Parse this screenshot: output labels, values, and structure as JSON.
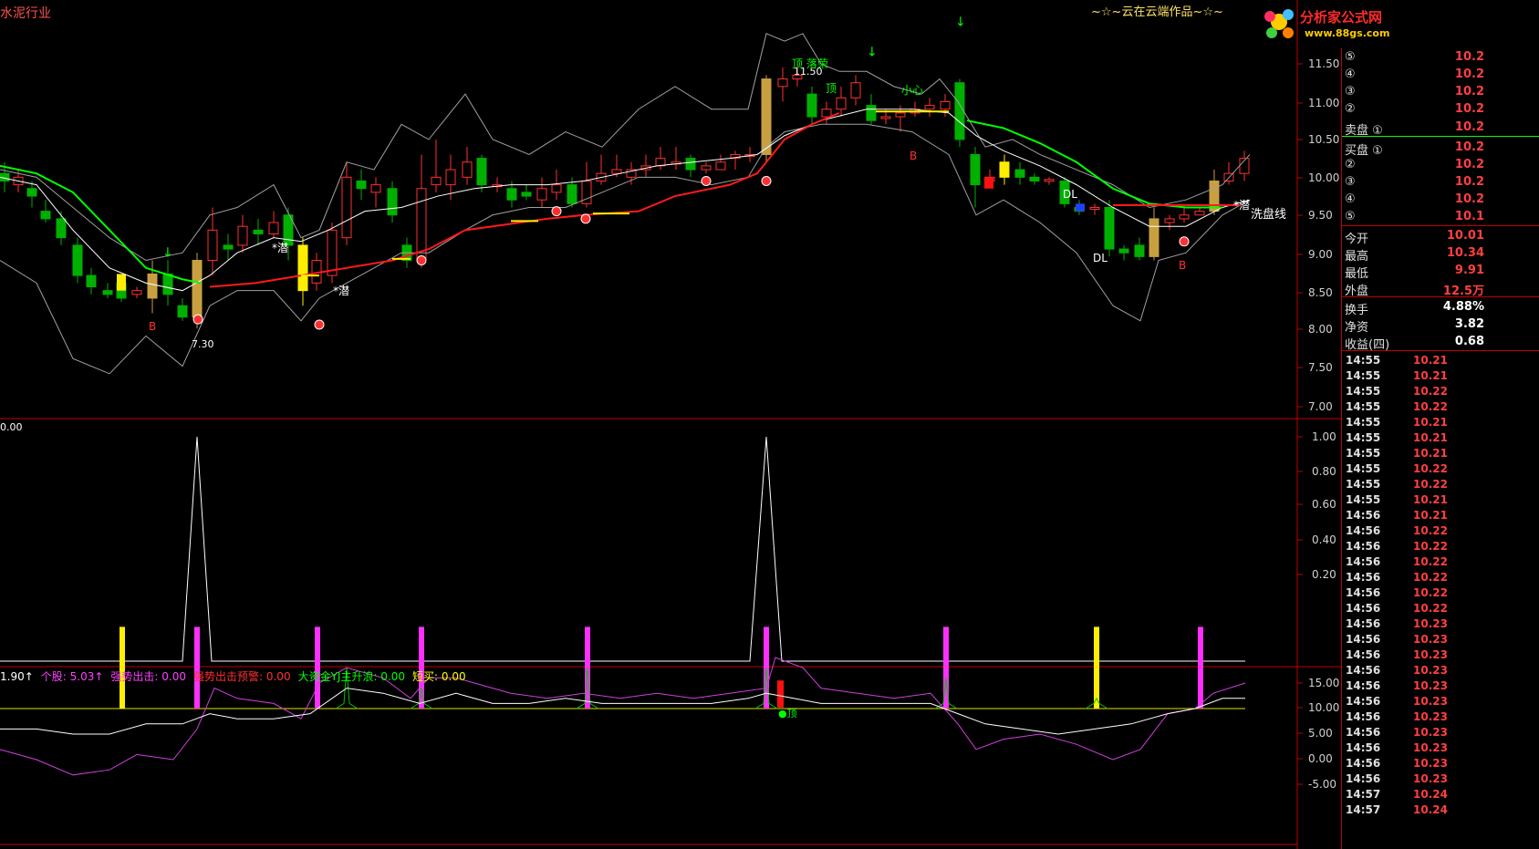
{
  "window": {
    "title": "水泥行业",
    "subtitle": "~☆~云在云端作品~☆~"
  },
  "logo": {
    "name": "分析家公式网",
    "url": "www.88gs.com"
  },
  "colors": {
    "up": "#ff3030",
    "down": "#00c000",
    "ma_fast": "#00ff00",
    "support": "#ff0000",
    "bg": "#000000",
    "frame": "#c00000"
  },
  "main_chart": {
    "y_ticks": [
      "11.50",
      "11.00",
      "10.50",
      "10.00",
      "9.50",
      "9.00",
      "8.50",
      "8.00",
      "7.50",
      "7.00"
    ],
    "labels": {
      "b1": "B",
      "b2": "B",
      "b3": "B",
      "p1": "7.30",
      "p2": "11.50",
      "qian1": "*潜",
      "qian2": "*潜",
      "qian3": "*潜",
      "ding": "顶",
      "xiaoxin": "小心",
      "dl1": "DL",
      "dl2": "DL",
      "xipan": "洗盘线",
      "dingwei": "顶 落荣"
    }
  },
  "sub1": {
    "value": "0.00",
    "y_ticks": [
      "1.00",
      "0.80",
      "0.60",
      "0.40",
      "0.20"
    ]
  },
  "sub2": {
    "legend": [
      {
        "text": "1.90↑",
        "color": "#ffffff"
      },
      {
        "text": "个股: 5.03↑",
        "color": "#ff40ff"
      },
      {
        "text": "强势出击: 0.00",
        "color": "#ff40ff"
      },
      {
        "text": "强势出击预警: 0.00",
        "color": "#ff3030"
      },
      {
        "text": "大资金YJ主升浪: 0.00",
        "color": "#00ff00"
      },
      {
        "text": "短买: 0.00",
        "color": "#ffff00"
      }
    ],
    "y_ticks": [
      "15.00",
      "10.00",
      "5.00",
      "0.00",
      "-5.00"
    ],
    "ding_label": "●顶"
  },
  "side_panel": {
    "ask": [
      {
        "k": "⑤",
        "v": "10.2"
      },
      {
        "k": "④",
        "v": "10.2"
      },
      {
        "k": "③",
        "v": "10.2"
      },
      {
        "k": "②",
        "v": "10.2"
      }
    ],
    "ask1": {
      "k": "卖盘 ①",
      "v": "10.2"
    },
    "bid1": {
      "k": "买盘 ①",
      "v": "10.2"
    },
    "bid": [
      {
        "k": "②",
        "v": "10.2"
      },
      {
        "k": "③",
        "v": "10.2"
      },
      {
        "k": "④",
        "v": "10.2"
      },
      {
        "k": "⑤",
        "v": "10.1"
      }
    ],
    "stats": [
      {
        "k": "今开",
        "v": "10.01",
        "c": "#ff4040"
      },
      {
        "k": "最高",
        "v": "10.34",
        "c": "#ff4040"
      },
      {
        "k": "最低",
        "v": "9.91",
        "c": "#ff4040"
      },
      {
        "k": "外盘",
        "v": "12.5万",
        "c": "#ff4040"
      }
    ],
    "stats2": [
      {
        "k": "换手",
        "v": "4.88%",
        "c": "#ffffff"
      },
      {
        "k": "净资",
        "v": "3.82",
        "c": "#ffffff"
      },
      {
        "k": "收益(四)",
        "v": "0.68",
        "c": "#ffffff"
      }
    ],
    "ticks": [
      [
        "14:55",
        "10.21"
      ],
      [
        "14:55",
        "10.21"
      ],
      [
        "14:55",
        "10.22"
      ],
      [
        "14:55",
        "10.22"
      ],
      [
        "14:55",
        "10.21"
      ],
      [
        "14:55",
        "10.21"
      ],
      [
        "14:55",
        "10.21"
      ],
      [
        "14:55",
        "10.22"
      ],
      [
        "14:55",
        "10.22"
      ],
      [
        "14:55",
        "10.21"
      ],
      [
        "14:56",
        "10.21"
      ],
      [
        "14:56",
        "10.22"
      ],
      [
        "14:56",
        "10.22"
      ],
      [
        "14:56",
        "10.22"
      ],
      [
        "14:56",
        "10.22"
      ],
      [
        "14:56",
        "10.22"
      ],
      [
        "14:56",
        "10.22"
      ],
      [
        "14:56",
        "10.23"
      ],
      [
        "14:56",
        "10.23"
      ],
      [
        "14:56",
        "10.23"
      ],
      [
        "14:56",
        "10.23"
      ],
      [
        "14:56",
        "10.23"
      ],
      [
        "14:56",
        "10.23"
      ],
      [
        "14:56",
        "10.23"
      ],
      [
        "14:56",
        "10.23"
      ],
      [
        "14:56",
        "10.23"
      ],
      [
        "14:56",
        "10.23"
      ],
      [
        "14:56",
        "10.23"
      ],
      [
        "14:57",
        "10.24"
      ],
      [
        "14:57",
        "10.24"
      ]
    ]
  }
}
